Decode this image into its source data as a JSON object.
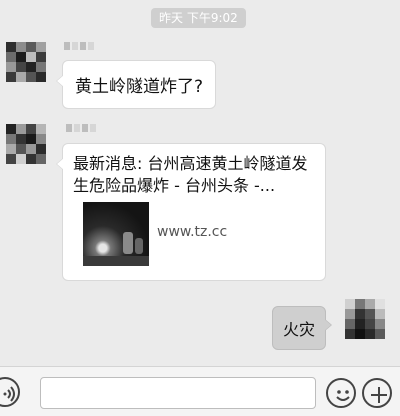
{
  "chat": {
    "timestamp": "昨天 下午9:02",
    "messages": [
      {
        "side": "left",
        "text": "黄土岭隧道炸了?"
      },
      {
        "side": "left",
        "type": "link-card",
        "title": "最新消息: 台州高速黄土岭隧道发生危险品爆炸 - 台州头条 -...",
        "domain": "www.tz.cc"
      },
      {
        "side": "right",
        "text": "火灾"
      }
    ]
  },
  "input_bar": {
    "text_value": ""
  },
  "icons": {
    "voice": "voice-icon",
    "emoji": "emoji-icon",
    "plus": "plus-icon"
  }
}
